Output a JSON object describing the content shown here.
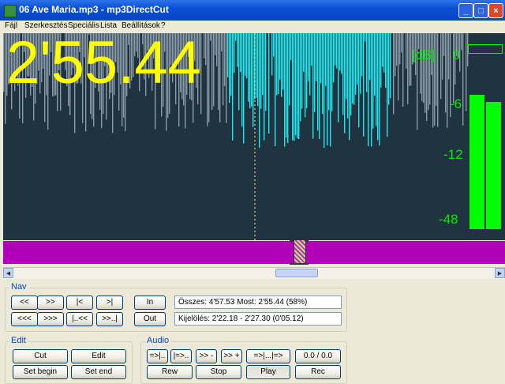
{
  "window": {
    "title": "06 Ave Maria.mp3 - mp3DirectCut"
  },
  "menu": [
    "Fájl",
    "Szerkesztés",
    "Speciális",
    "Lista",
    "Beállítások",
    "?"
  ],
  "display": {
    "time": "2'55.44",
    "db_unit": "[dB]",
    "db_ticks": [
      "0",
      "-6",
      "-12",
      "-48"
    ],
    "meter_left_level": 0.76,
    "meter_right_level": 0.72
  },
  "colors": {
    "wave_bg": "#1f3341",
    "wave_normal": "#8a9aa6",
    "wave_selected": "#22e8ee",
    "readout": "#ffff00",
    "meter": "#00ff00",
    "timeline": "#b000b8"
  },
  "nav": {
    "label": "Nav",
    "buttons_row1": [
      "<<",
      ">>",
      "|<",
      ">|"
    ],
    "buttons_row2": [
      "<<<",
      ">>>",
      "|..<<",
      ">>..|"
    ],
    "in_label": "In",
    "out_label": "Out",
    "total_info": "Összes: 4'57.53  Most: 2'55.44  (58%)",
    "selection_info": "Kijelölés: 2'22.18 - 2'27.30 (0'05.12)"
  },
  "edit": {
    "label": "Edit",
    "buttons": [
      "Cut",
      "Edit",
      "Set begin",
      "Set end"
    ]
  },
  "audio": {
    "label": "Audio",
    "buttons_row1": [
      "=>|..",
      "|=>..",
      ">> -",
      ">> +",
      "=>|...|=>",
      "0.0 / 0.0"
    ],
    "buttons_row2": [
      "Rew",
      "Stop",
      "Play",
      "Rec"
    ]
  }
}
